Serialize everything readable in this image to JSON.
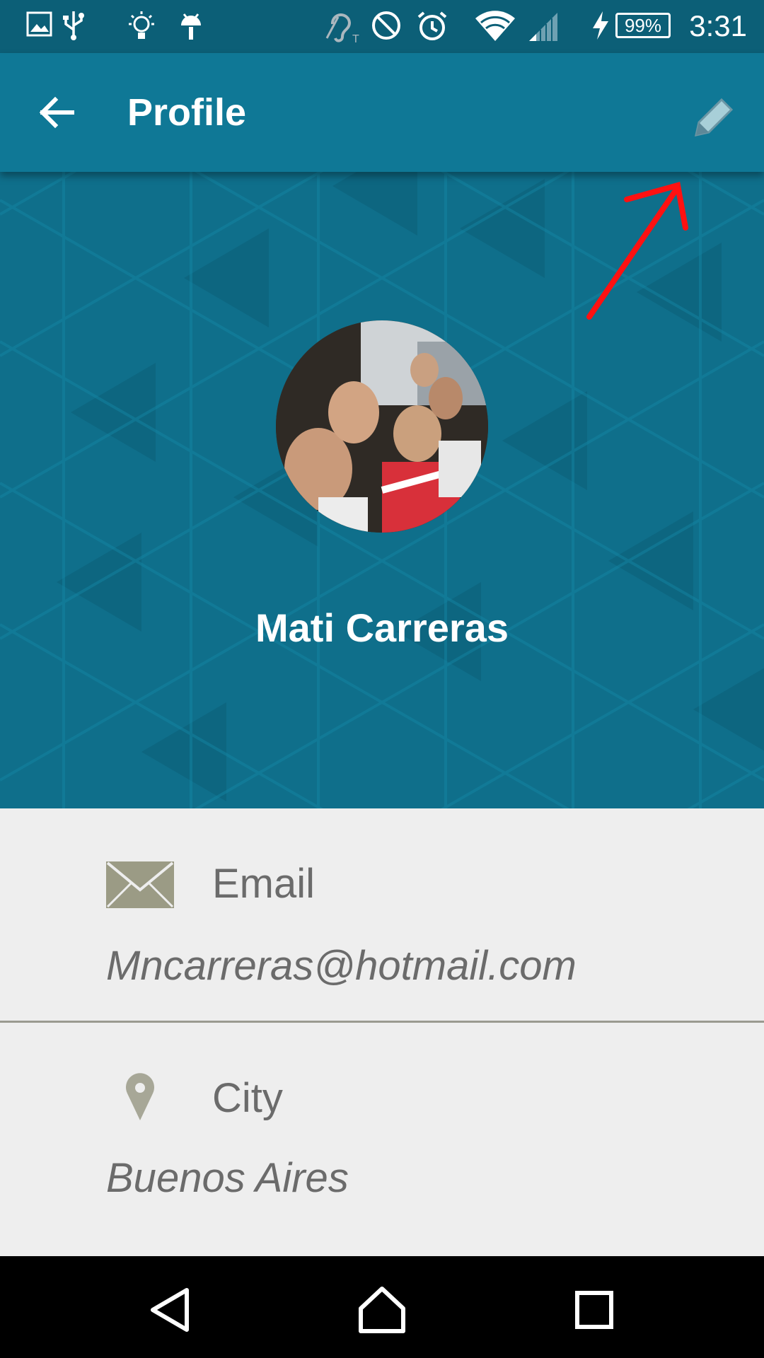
{
  "status_bar": {
    "time": "3:31",
    "battery": "99%",
    "icons": [
      "image-icon",
      "usb-icon",
      "lightbulb-icon",
      "android-icon",
      "hearing-aid-icon",
      "do-not-disturb-icon",
      "alarm-icon",
      "wifi-icon",
      "signal-icon",
      "charging-icon"
    ]
  },
  "app_bar": {
    "title": "Profile",
    "back_icon": "arrow-back-icon",
    "edit_icon": "pencil-icon"
  },
  "profile": {
    "name": "Mati Carreras"
  },
  "fields": {
    "email": {
      "label": "Email",
      "value": "Mncarreras@hotmail.com",
      "icon": "envelope-icon"
    },
    "city": {
      "label": "City",
      "value": "Buenos Aires",
      "icon": "location-pin-icon"
    }
  },
  "nav_bar": {
    "icons": [
      "back-triangle-icon",
      "home-icon",
      "recents-icon"
    ]
  },
  "colors": {
    "status_bar": "#0c5f77",
    "app_bar": "#0f7896",
    "header": "#0f6f8b",
    "body": "#eeeeee",
    "annotation": "#ff1111"
  }
}
